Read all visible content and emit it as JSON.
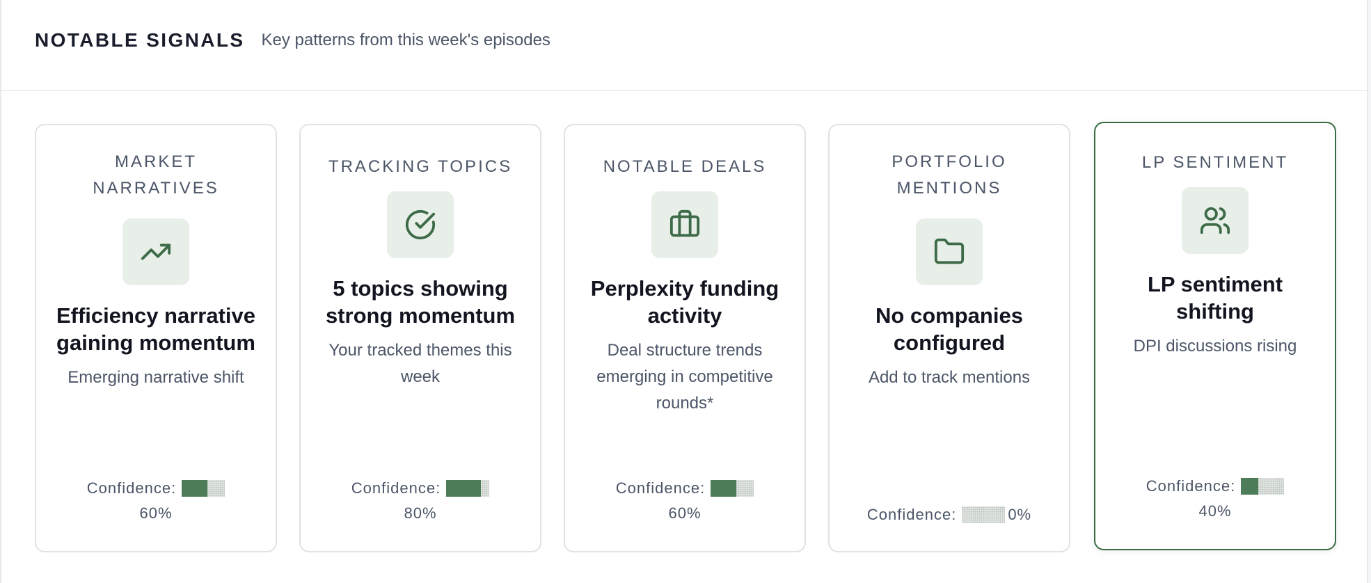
{
  "header": {
    "title": "NOTABLE SIGNALS",
    "subtitle": "Key patterns from this week's episodes"
  },
  "accent_color": "#4d7c59",
  "icon_bg_color": "#e8efe9",
  "cards": [
    {
      "category": "MARKET NARRATIVES",
      "icon": "trending-up-icon",
      "headline": "Efficiency narrative gaining momentum",
      "description": "Emerging narrative shift",
      "confidence_label": "Confidence:",
      "confidence_value": 0.6,
      "confidence_text": "60%"
    },
    {
      "category": "TRACKING TOPICS",
      "icon": "check-circle-icon",
      "headline": "5 topics showing strong momentum",
      "description": "Your tracked themes this week",
      "confidence_label": "Confidence:",
      "confidence_value": 0.8,
      "confidence_text": "80%"
    },
    {
      "category": "NOTABLE DEALS",
      "icon": "briefcase-icon",
      "headline": "Perplexity funding activity",
      "description": "Deal structure trends emerging in competitive rounds*",
      "confidence_label": "Confidence:",
      "confidence_value": 0.6,
      "confidence_text": "60%"
    },
    {
      "category": "PORTFOLIO MENTIONS",
      "icon": "folder-icon",
      "headline": "No companies configured",
      "description": "Add to track mentions",
      "confidence_label": "Confidence:",
      "confidence_value": 0.0,
      "confidence_text": "0%"
    },
    {
      "category": "LP SENTIMENT",
      "icon": "users-icon",
      "headline": "LP sentiment shifting",
      "description": "DPI discussions rising",
      "confidence_label": "Confidence:",
      "confidence_value": 0.4,
      "confidence_text": "40%",
      "active": true
    }
  ]
}
